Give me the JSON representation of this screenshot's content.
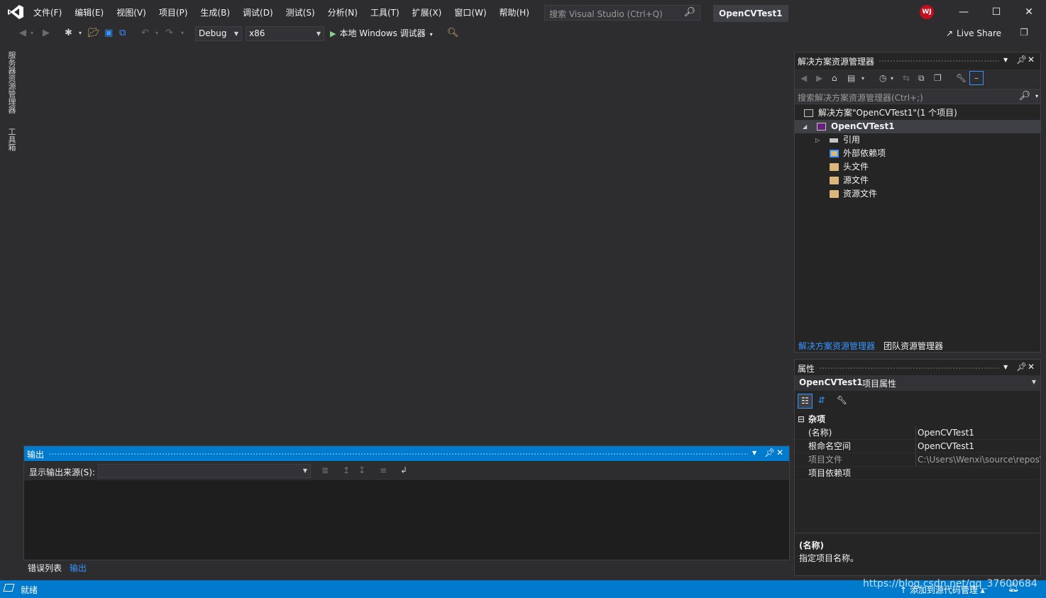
{
  "menu": {
    "items": [
      "文件(F)",
      "编辑(E)",
      "视图(V)",
      "项目(P)",
      "生成(B)",
      "调试(D)",
      "测试(S)",
      "分析(N)",
      "工具(T)",
      "扩展(X)",
      "窗口(W)",
      "帮助(H)"
    ]
  },
  "search": {
    "placeholder": "搜索 Visual Studio (Ctrl+Q)"
  },
  "solution_title": "OpenCVTest1",
  "user": {
    "initials": "WJ"
  },
  "toolbar": {
    "config": "Debug",
    "platform": "x86",
    "run_label": "本地 Windows 调试器",
    "live_share": "Live Share"
  },
  "left_strip": {
    "tabs": [
      "服务器资源管理器",
      "工具箱"
    ]
  },
  "output": {
    "title": "输出",
    "source_label": "显示输出来源(S):",
    "source_value": ""
  },
  "bottom_tabs": [
    "错误列表",
    "输出"
  ],
  "solution_explorer": {
    "title": "解决方案资源管理器",
    "search_placeholder": "搜索解决方案资源管理器(Ctrl+;)",
    "tree": [
      {
        "label": "解决方案\"OpenCVTest1\"(1 个项目)"
      },
      {
        "label": "OpenCVTest1"
      },
      {
        "label": "引用"
      },
      {
        "label": "外部依赖项"
      },
      {
        "label": "头文件"
      },
      {
        "label": "源文件"
      },
      {
        "label": "资源文件"
      }
    ],
    "tabs": [
      "解决方案资源管理器",
      "团队资源管理器"
    ]
  },
  "properties": {
    "title": "属性",
    "object_name": "OpenCVTest1",
    "object_type": "项目属性",
    "category": "杂项",
    "rows": [
      {
        "name": "(名称)",
        "value": "OpenCVTest1"
      },
      {
        "name": "根命名空间",
        "value": "OpenCVTest1"
      },
      {
        "name": "项目文件",
        "value": "C:\\Users\\Wenxi\\source\\repos\\"
      },
      {
        "name": "项目依赖项",
        "value": ""
      }
    ],
    "desc_title": "(名称)",
    "desc_text": "指定项目名称。"
  },
  "statusbar": {
    "ready": "就绪",
    "scm": "↑ 添加到源代码管理 ▴"
  },
  "watermark": "https://blog.csdn.net/qq_37600684",
  "colors": {
    "accent": "#007acc",
    "background": "#2d2d30",
    "avatar": "#c40d1e"
  }
}
